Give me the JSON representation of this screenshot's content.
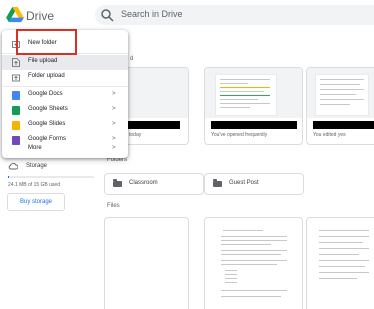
{
  "brand": {
    "name": "Drive"
  },
  "search": {
    "placeholder": "Search in Drive"
  },
  "breadcrumb": {
    "tail": "e",
    "chevron": "▾"
  },
  "sections": {
    "suggested": "d",
    "folders": "Folders",
    "files": "Files"
  },
  "suggested_cards": [
    {
      "caption": "today"
    },
    {
      "caption": "You've opened frequently"
    },
    {
      "caption": "You edited yes"
    }
  ],
  "folders": [
    {
      "name": "Classroom"
    },
    {
      "name": "Guest Post"
    }
  ],
  "sidebar": {
    "storage_label": "Storage",
    "storage_used": "24.1 MB of 15 GB used",
    "storage_fraction": 0.0016,
    "buy_storage": "Buy storage"
  },
  "new_menu": {
    "items": [
      {
        "label": "New folder",
        "icon": "new-folder-icon"
      },
      {
        "label": "File upload",
        "icon": "file-upload-icon"
      },
      {
        "label": "Folder upload",
        "icon": "folder-upload-icon"
      },
      {
        "label": "Google Docs",
        "icon": "docs-icon",
        "chevron": ">"
      },
      {
        "label": "Google Sheets",
        "icon": "sheets-icon",
        "chevron": ">"
      },
      {
        "label": "Google Slides",
        "icon": "slides-icon",
        "chevron": ">"
      },
      {
        "label": "Google Forms",
        "icon": "forms-icon",
        "chevron": ">"
      },
      {
        "label": "More",
        "chevron": ">"
      }
    ]
  },
  "colors": {
    "accent": "#1a73e8",
    "highlight_box": "#d93025",
    "docs": "#4285f4",
    "sheets": "#0f9d58",
    "slides": "#f4b400",
    "forms": "#7248b9"
  }
}
